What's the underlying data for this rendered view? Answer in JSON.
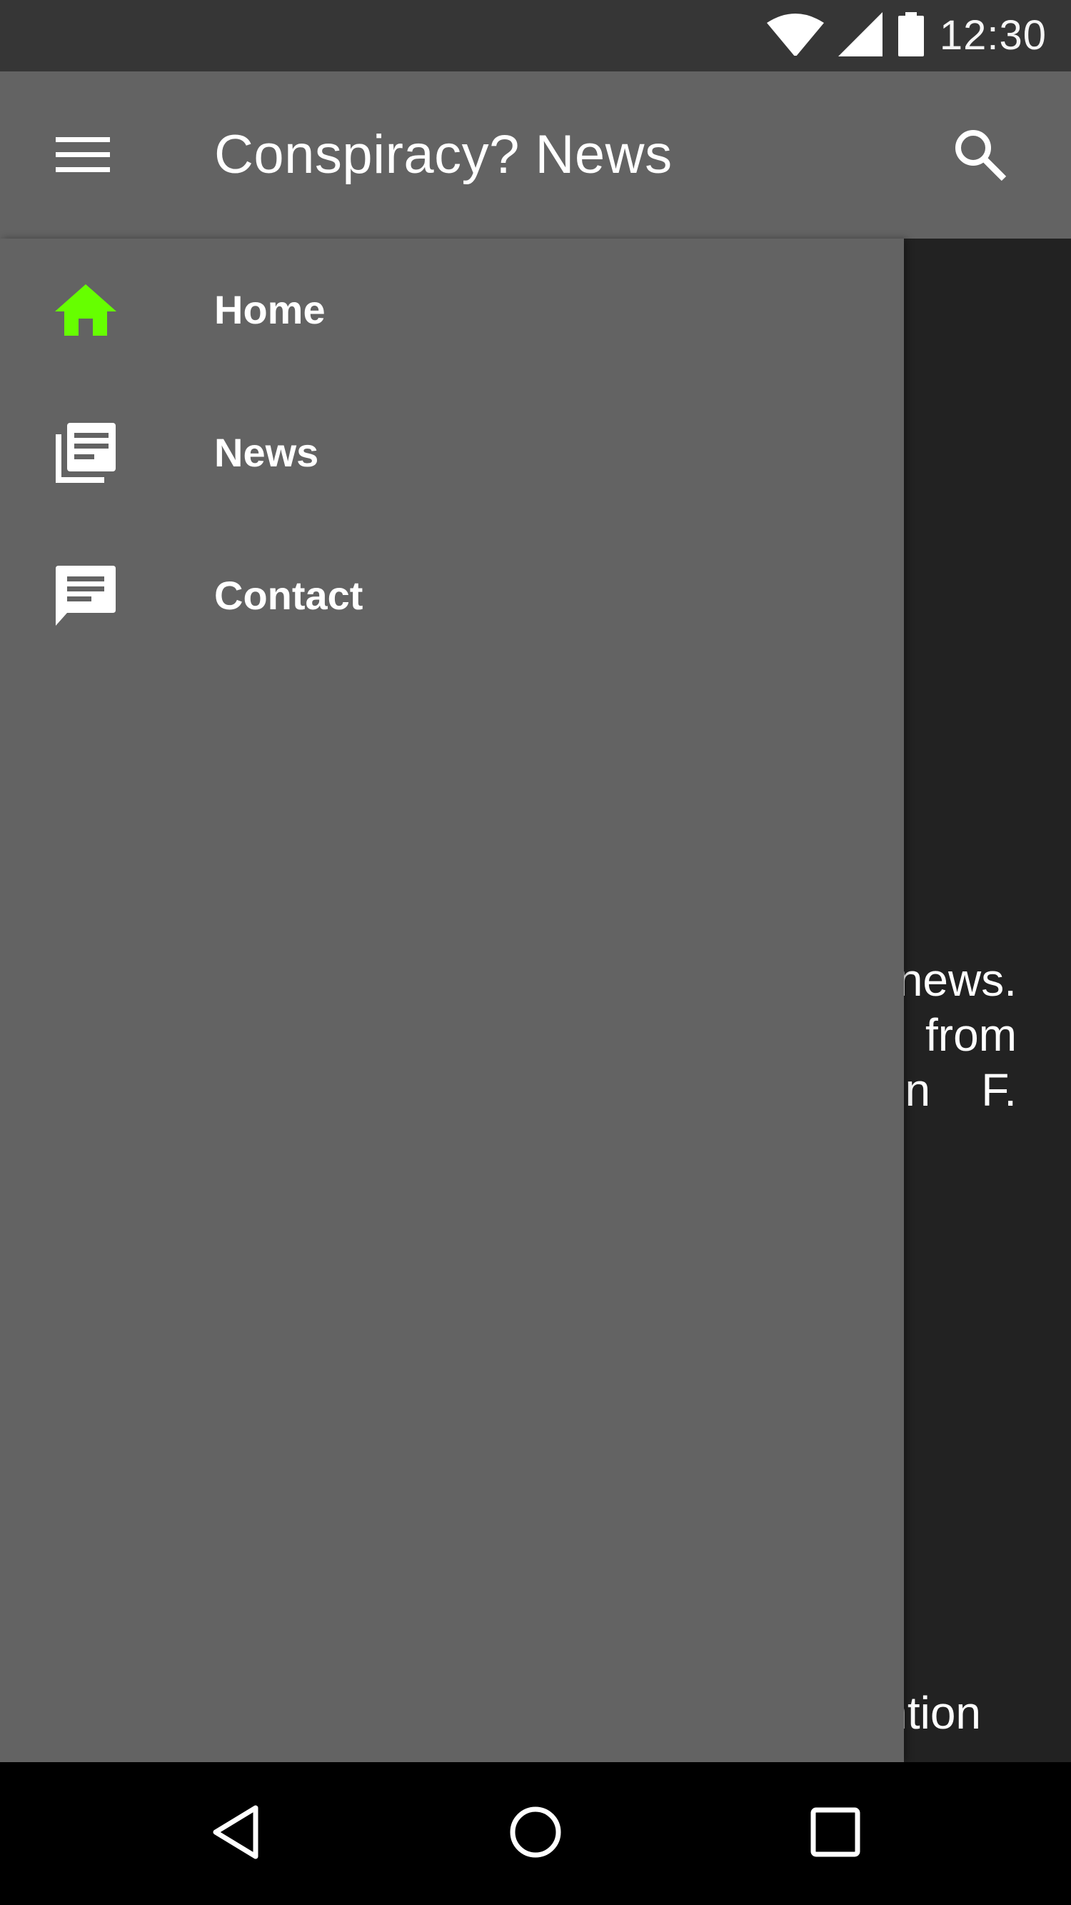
{
  "status_bar": {
    "time": "12:30",
    "icons": [
      "wifi-icon",
      "cellular-signal-icon",
      "battery-icon"
    ]
  },
  "app_bar": {
    "title": "Conspiracy? News",
    "menu_icon": "hamburger-menu-icon",
    "search_icon": "search-icon"
  },
  "drawer": {
    "items": [
      {
        "label": "Home",
        "icon": "home-icon",
        "selected": true
      },
      {
        "label": "News",
        "icon": "newspaper-icon",
        "selected": false
      },
      {
        "label": "Contact",
        "icon": "chat-icon",
        "selected": false
      }
    ]
  },
  "background_content": {
    "lines": [
      "news.",
      "from",
      "nn    F."
    ],
    "bottom_line": "ntion"
  },
  "nav_bar": {
    "buttons": [
      "back-icon",
      "home-circle-icon",
      "recents-icon"
    ]
  },
  "colors": {
    "accent": "#66ff00",
    "status_bar": "#363636",
    "app_bar": "#636363",
    "drawer": "#636363",
    "background": "#222222",
    "nav_bar": "#000000",
    "text": "#ffffff"
  }
}
